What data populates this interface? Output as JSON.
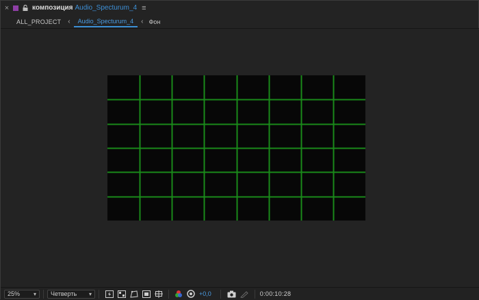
{
  "colors": {
    "label_swatch": "#8e3fa5",
    "accent": "#3d8fd6",
    "grid_line": "#1a8a1a",
    "canvas_bg": "#070707"
  },
  "header": {
    "close_icon": "close-icon",
    "title_label": "композиция",
    "comp_name": "Audio_Specturum_4",
    "menu_icon": "hamburger-menu-icon"
  },
  "breadcrumb": {
    "root": "ALL_PROJECT",
    "active": "Audio_Specturum_4",
    "layer": "Фон"
  },
  "canvas": {
    "columns": 8,
    "rows": 6
  },
  "toolbar": {
    "zoom": "25%",
    "resolution": "Четверть",
    "exposure": "+0,0",
    "timecode": "0:00:10:28",
    "icons": [
      "fast-preview-icon",
      "transparency-grid-icon",
      "mask-visibility-icon",
      "region-of-interest-icon",
      "grid-guides-icon",
      "color-channels-icon",
      "color-management-icon",
      "snapshot-icon",
      "show-snapshot-icon"
    ]
  }
}
